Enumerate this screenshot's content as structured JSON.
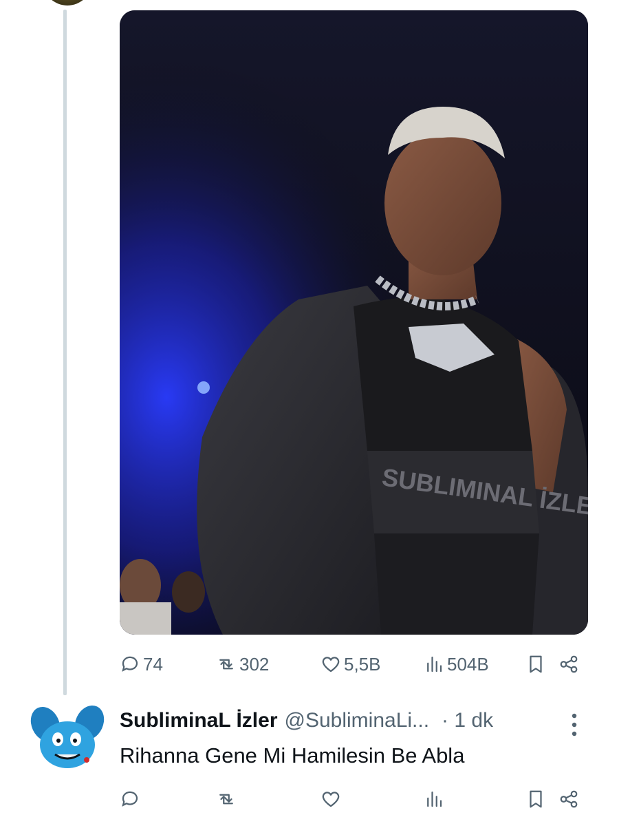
{
  "tweet": {
    "image_alt": "Performer on stage wearing a black crop top with printed waistband",
    "waistband_text": "SUBLIMINAL İZLER",
    "stats": {
      "replies": "74",
      "retweets": "302",
      "likes": "5,5B",
      "views": "504B"
    }
  },
  "reply": {
    "display_name": "SubliminaL İzler",
    "handle": "@SubliminaLi...",
    "time": "· 1 dk",
    "text": "Rihanna Gene Mi Hamilesin Be Abla",
    "stats": {
      "replies": "",
      "retweets": "",
      "likes": "",
      "views": ""
    }
  },
  "icons": {
    "reply": "speech-bubble-icon",
    "retweet": "retweet-arrows-icon",
    "like": "heart-icon",
    "views": "bar-chart-icon",
    "bookmark": "bookmark-icon",
    "share": "share-nodes-icon",
    "more": "vertical-ellipsis-icon"
  },
  "colors": {
    "text_primary": "#0f1419",
    "text_secondary": "#536471",
    "thread_line": "#cfd9de"
  }
}
